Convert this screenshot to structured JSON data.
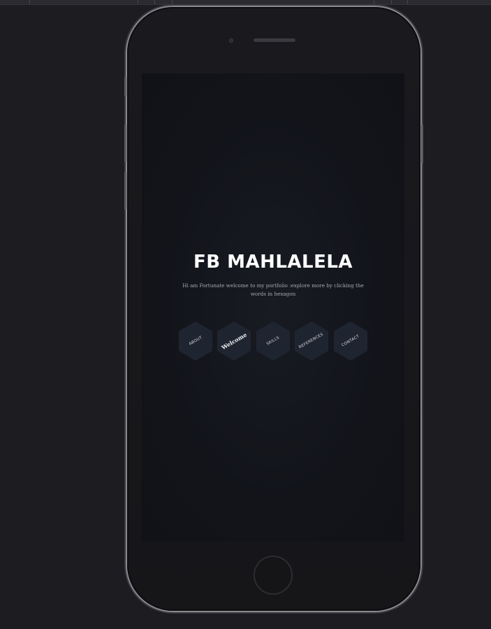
{
  "hero": {
    "title": "FB MAHLALELA",
    "subtitle": "Hi am Fortunate welcome to my portfolio :explore more by clicking the words in hexagon"
  },
  "nav": {
    "items": [
      {
        "label": "ABOUT"
      },
      {
        "label": "Welcome"
      },
      {
        "label": "SKILLS"
      },
      {
        "label": "REFERENCES"
      },
      {
        "label": "CONTACT"
      }
    ]
  },
  "colors": {
    "page_background": "#1c1c21",
    "screen_background": "#12141a",
    "hexagon_fill": "#1f2530",
    "title_color": "#ffffff",
    "subtitle_color": "#a7a9b0"
  }
}
